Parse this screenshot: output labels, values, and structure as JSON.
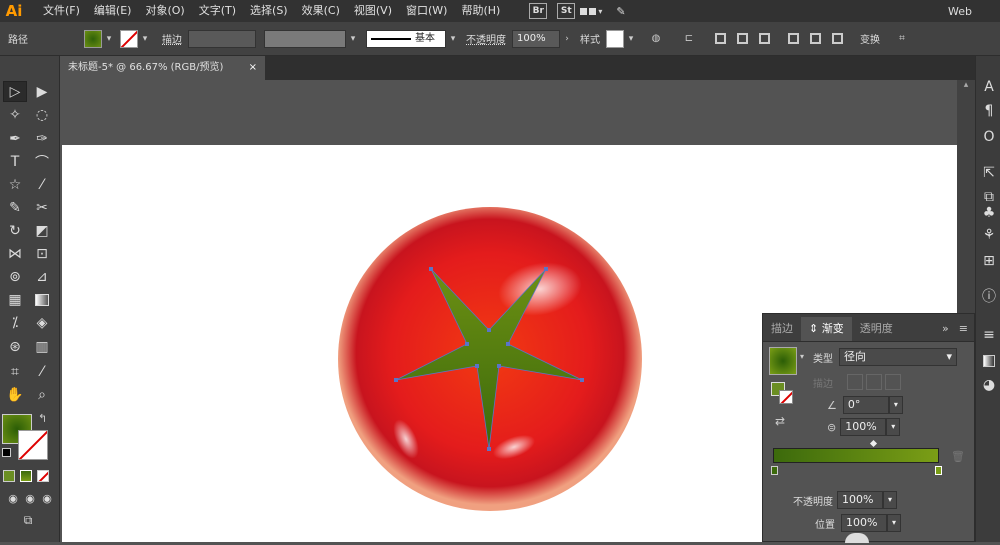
{
  "app": {
    "logo": "Ai",
    "workspace": "Web"
  },
  "menu": [
    "文件(F)",
    "编辑(E)",
    "对象(O)",
    "文字(T)",
    "选择(S)",
    "效果(C)",
    "视图(V)",
    "窗口(W)",
    "帮助(H)"
  ],
  "app_icons": [
    "Br",
    "St"
  ],
  "control": {
    "selection_label": "路径",
    "stroke_label": "描边",
    "stroke_style": "基本",
    "opacity_label": "不透明度",
    "opacity_value": "100%",
    "style_label": "样式",
    "transform_label": "变换"
  },
  "doc_tab": {
    "title": "未标题-5* @ 66.67% (RGB/预览)",
    "close": "×"
  },
  "colors": {
    "green": "#668c1a",
    "tomato": "#e02121",
    "canvas": "#ffffff"
  },
  "gradient_panel": {
    "tabs": [
      "描边",
      "渐变",
      "透明度"
    ],
    "type_label": "类型",
    "type_value": "径向",
    "stroke_label": "描边",
    "angle_value": "0°",
    "aspect_value": "100%",
    "opacity_label": "不透明度",
    "opacity_value": "100%",
    "location_label": "位置",
    "location_value": "100%"
  }
}
